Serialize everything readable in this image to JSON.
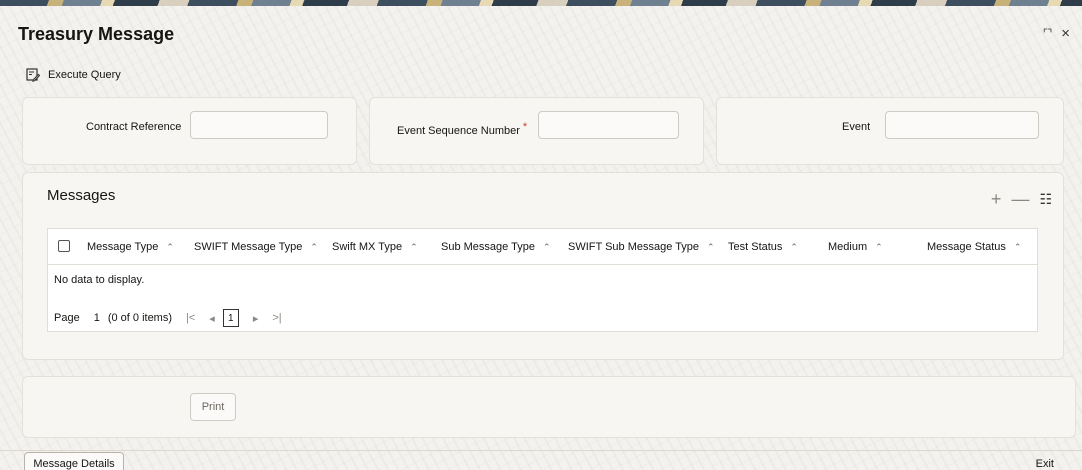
{
  "window": {
    "title": "Treasury Message",
    "maximize_glyph": "⌜⌝",
    "close_glyph": "×"
  },
  "toolbar": {
    "execute_query_label": "Execute Query"
  },
  "fields": {
    "contract_reference": {
      "label": "Contract Reference",
      "value": ""
    },
    "event_sequence_number": {
      "label": "Event Sequence Number",
      "required_mark": "*",
      "value": ""
    },
    "event": {
      "label": "Event",
      "value": ""
    }
  },
  "messages": {
    "title": "Messages",
    "actions": {
      "add": "+",
      "remove": "—",
      "columns": "☷"
    },
    "columns": [
      "Message Type",
      "SWIFT Message Type",
      "Swift MX Type",
      "Sub Message Type",
      "SWIFT Sub Message Type",
      "Test Status",
      "Medium",
      "Message Status"
    ],
    "sort_glyph": "⌃",
    "empty_text": "No data to display.",
    "pager": {
      "page_label": "Page",
      "page_value": "1",
      "items_info": "(0 of 0 items)",
      "first": "|<",
      "prev": "◂",
      "current": "1",
      "next": "▸",
      "last": ">|"
    }
  },
  "buttons": {
    "print": "Print",
    "message_details": "Message Details",
    "exit": "Exit"
  },
  "colors": {
    "background": "#f3f2ef",
    "panel": "#f7f6f3",
    "required": "#d63b25"
  },
  "icons": {
    "execute_query": "query-edit-icon",
    "add": "plus-icon",
    "remove": "minus-icon",
    "columns": "column-list-icon"
  }
}
